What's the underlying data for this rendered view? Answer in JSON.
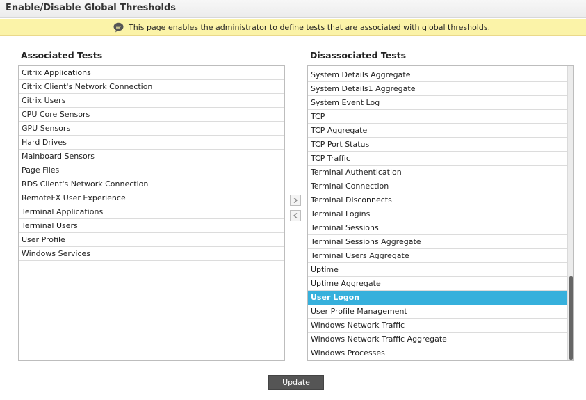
{
  "page": {
    "title": "Enable/Disable Global Thresholds",
    "info_text": "This page enables the administrator to define tests that are associated with global thresholds."
  },
  "associated": {
    "heading": "Associated Tests",
    "items": [
      "Citrix Applications",
      "Citrix Client's Network Connection",
      "Citrix Users",
      "CPU Core Sensors",
      "GPU Sensors",
      "Hard Drives",
      "Mainboard Sensors",
      "Page Files",
      "RDS Client's Network Connection",
      "RemoteFX User Experience",
      "Terminal Applications",
      "Terminal Users",
      "User Profile",
      "Windows Services"
    ]
  },
  "disassociated": {
    "heading": "Disassociated Tests",
    "items": [
      "System Details Aggregate",
      "System Details1 Aggregate",
      "System Event Log",
      "TCP",
      "TCP Aggregate",
      "TCP Port Status",
      "TCP Traffic",
      "Terminal Authentication",
      "Terminal Connection",
      "Terminal Disconnects",
      "Terminal Logins",
      "Terminal Sessions",
      "Terminal Sessions Aggregate",
      "Terminal Users Aggregate",
      "Uptime",
      "Uptime Aggregate",
      "User Logon",
      "User Profile Management",
      "Windows Network Traffic",
      "Windows Network Traffic Aggregate",
      "Windows Processes"
    ],
    "selected": "User Logon"
  },
  "controls": {
    "update_label": "Update"
  },
  "colors": {
    "selection": "#36b0dc",
    "info_background": "#fbf3a8",
    "button": "#555555"
  },
  "icons": {
    "info": "speech-bubble-info-icon",
    "move_right": "chevron-right-icon",
    "move_left": "chevron-left-icon"
  }
}
